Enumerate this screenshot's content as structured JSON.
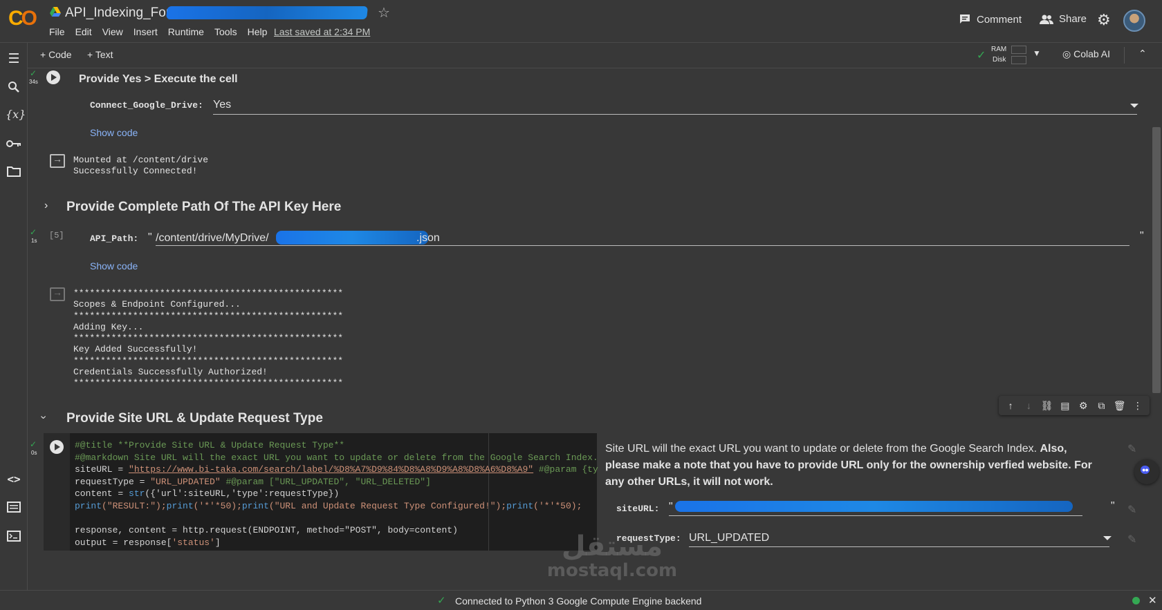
{
  "header": {
    "logo": "CO",
    "title": "API_Indexing_For_",
    "menu": [
      "File",
      "Edit",
      "View",
      "Insert",
      "Runtime",
      "Tools",
      "Help"
    ],
    "last_saved": "Last saved at 2:34 PM",
    "comment_label": "Comment",
    "share_label": "Share"
  },
  "toolbar": {
    "add_code": "+ Code",
    "add_text": "+ Text",
    "ram_label": "RAM",
    "disk_label": "Disk",
    "colab_ai": "Colab AI"
  },
  "cells": {
    "cell1": {
      "exec_time": "34s",
      "heading": "Provide Yes > Execute the cell",
      "param_label": "Connect_Google_Drive:",
      "param_value": "Yes",
      "show_code": "Show code",
      "output": "Mounted at /content/drive\nSuccessfully Connected!"
    },
    "section2": {
      "heading": "Provide Complete Path Of The API Key Here"
    },
    "cell2": {
      "exec_count": "[5]",
      "exec_time": "1s",
      "param_label": "API_Path:",
      "quote_open": "\"",
      "param_value": "/content/drive/MyDrive/",
      "param_suffix": ".json",
      "quote_close": "\"",
      "show_code": "Show code",
      "output": "**************************************************\nScopes & Endpoint Configured...\n**************************************************\nAdding Key...\n**************************************************\nKey Added Successfully!\n**************************************************\nCredentials Successfully Authorized!\n**************************************************"
    },
    "section3": {
      "heading": "Provide Site URL & Update Request Type"
    },
    "cell3": {
      "exec_time": "0s",
      "code": {
        "l1": "#@title **Provide Site URL & Update Request Type**",
        "l2": "#@markdown Site URL will the exact URL you want to update or delete from the Google Search Index.",
        "l3a": "siteURL = ",
        "l3b": "\"https://www.bi-taka.com/search/label/%D8%A7%D9%84%D8%A8%D9%A8%D8%A6%D8%A9\"",
        "l3c": " #@param {ty",
        "l4a": "requestType = ",
        "l4b": "\"URL_UPDATED\"",
        "l4c": " #@param [\"URL_UPDATED\", \"URL_DELETED\"]",
        "l5a": "content = ",
        "l5b": "str",
        "l5c": "({'url':siteURL,'type':requestType})",
        "l6a": "print",
        "l6b": "(\"RESULT:\");",
        "l6c": "print",
        "l6d": "('*'*50);",
        "l6e": "print",
        "l6f": "(\"URL and Update Request Type Configured!\");",
        "l6g": "print",
        "l6h": "('*'*50);",
        "l8": "response, content = http.request(ENDPOINT, method=\"POST\", body=content)",
        "l9a": "output = response[",
        "l9b": "'status'",
        "l9c": "]"
      },
      "desc_plain": "Site URL will the exact URL you want to update or delete from the Google Search Index. ",
      "desc_bold": "Also, please make a note that you have to provide URL only for the ownership verfied website. For any other URLs, it will not work.",
      "site_label": "siteURL:",
      "site_quote_open": "\"",
      "site_quote_close": "\"",
      "request_label": "requestType:",
      "request_value": "URL_UPDATED"
    }
  },
  "watermark": {
    "arabic": "مستقل",
    "latin": "mostaql.com"
  },
  "status": {
    "text": "Connected to Python 3 Google Compute Engine backend"
  },
  "colors": {
    "background": "#383838",
    "code_bg": "#1e1e1e",
    "link": "#8ab4f8",
    "success": "#34a853",
    "redaction": "#1a73e8"
  }
}
